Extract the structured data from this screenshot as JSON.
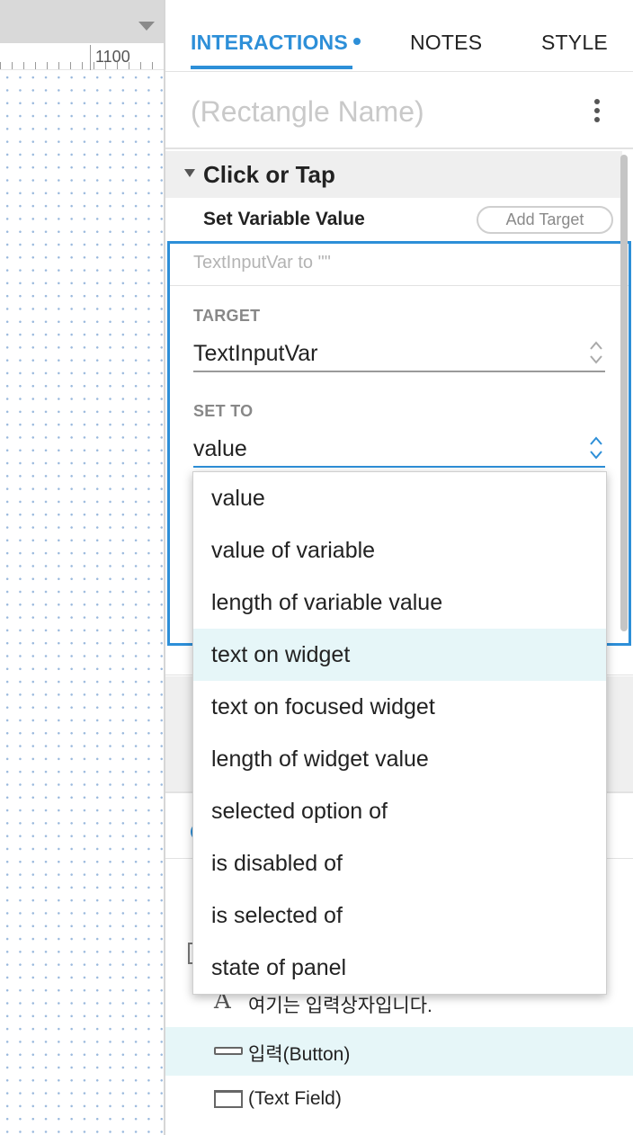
{
  "canvas": {
    "ruler_label": "1100"
  },
  "tabs": {
    "interactions": "INTERACTIONS",
    "notes": "NOTES",
    "style": "STYLE"
  },
  "widget": {
    "name_placeholder": "(Rectangle Name)"
  },
  "event": {
    "title": "Click or Tap"
  },
  "action": {
    "title": "Set Variable Value",
    "add_target_label": "Add Target",
    "summary": "TextInputVar to \"\"",
    "target_label": "TARGET",
    "target_value": "TextInputVar",
    "set_to_label": "SET TO",
    "set_to_value": "value"
  },
  "dropdown": {
    "options": [
      "value",
      "value of variable",
      "length of variable value",
      "text on widget",
      "text on focused widget",
      "length of widget value",
      "selected option of",
      "is disabled of",
      "is selected of",
      "state of panel"
    ],
    "highlighted": "text on widget"
  },
  "outline": {
    "items": [
      {
        "icon": "text-icon",
        "label": "여기는 입력상자입니다.",
        "selected": false
      },
      {
        "icon": "button-icon",
        "label": "입력(Button)",
        "selected": true
      },
      {
        "icon": "text-field-icon",
        "label": "(Text Field)",
        "selected": false
      }
    ]
  },
  "colors": {
    "accent": "#2d8fd8",
    "highlight": "#e6f6f8",
    "section_bg": "#efefef"
  }
}
